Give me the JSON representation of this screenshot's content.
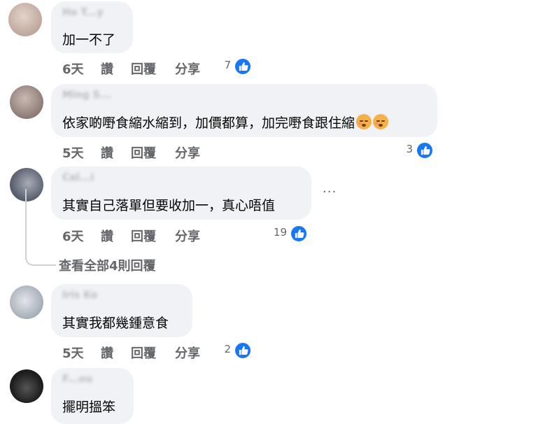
{
  "comments": [
    {
      "author": "Ho T...y",
      "text": "加一不了",
      "time": "6天",
      "like_label": "讚",
      "reply_label": "回覆",
      "share_label": "分享",
      "likes": "7",
      "avatar_color": "#cdb9b0"
    },
    {
      "author": "Ming S...",
      "text": "依家啲嘢食縮水縮到，加價都算，加完嘢食跟住縮",
      "emojis": [
        "weary-face-emoji",
        "weary-face-emoji"
      ],
      "time": "5天",
      "like_label": "讚",
      "reply_label": "回覆",
      "share_label": "分享",
      "likes": "3",
      "avatar_color": "#9c8a86"
    },
    {
      "author": "Cal...i",
      "text": "其實自己落單但要收加一，真心唔值",
      "time": "6天",
      "like_label": "讚",
      "reply_label": "回覆",
      "share_label": "分享",
      "likes": "19",
      "avatar_color": "#6c7280",
      "more": "···",
      "view_replies": "查看全部4則回覆"
    },
    {
      "author": "Iris Ko",
      "text": "其實我都幾鍾意食",
      "time": "5天",
      "like_label": "讚",
      "reply_label": "回覆",
      "share_label": "分享",
      "likes": "2",
      "avatar_color": "#b2b8c0"
    },
    {
      "author": "F...ou",
      "text": "擺明搵笨",
      "avatar_color": "#2b2b2b"
    }
  ],
  "colors": {
    "like_blue": "#1877f2",
    "bubble_bg": "#f0f2f5",
    "meta_gray": "#65676b"
  }
}
